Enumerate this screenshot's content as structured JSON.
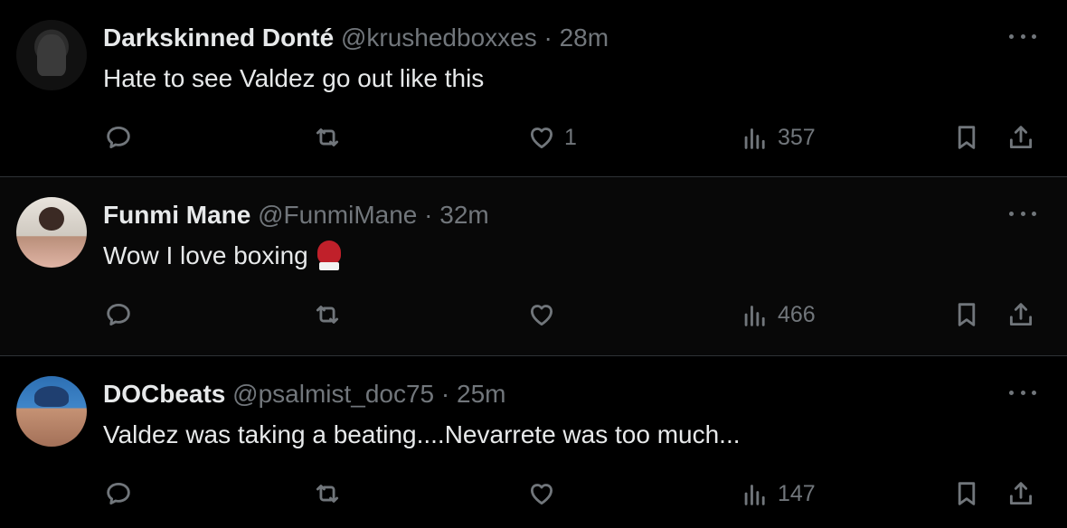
{
  "tweets": [
    {
      "name": "Darkskinned Donté",
      "handle": "@krushedboxxes",
      "dot": "·",
      "time": "28m",
      "text": "Hate to see Valdez go out like this",
      "likes": "1",
      "views": "357",
      "avatar_icon": "profile-photo"
    },
    {
      "name": "Funmi Mane",
      "handle": "@FunmiMane",
      "dot": "·",
      "time": "32m",
      "text": "Wow I love boxing",
      "emoji_icon": "boxing-glove-emoji",
      "likes": "",
      "views": "466",
      "avatar_icon": "profile-photo"
    },
    {
      "name": "DOCbeats",
      "handle": "@psalmist_doc75",
      "dot": "·",
      "time": "25m",
      "text": "Valdez was taking a beating....Nevarrete was too much...",
      "likes": "",
      "views": "147",
      "avatar_icon": "profile-photo"
    }
  ],
  "icons": {
    "reply": "reply-bubble-icon",
    "retweet": "retweet-arrows-icon",
    "like": "heart-icon",
    "views": "bar-chart-icon",
    "bookmark": "bookmark-icon",
    "share": "share-upload-icon",
    "more": "more-dots-icon"
  },
  "colors": {
    "background": "#000000",
    "primary_text": "#e7e9ea",
    "secondary_text": "#71767b",
    "divider": "#2f3336"
  }
}
